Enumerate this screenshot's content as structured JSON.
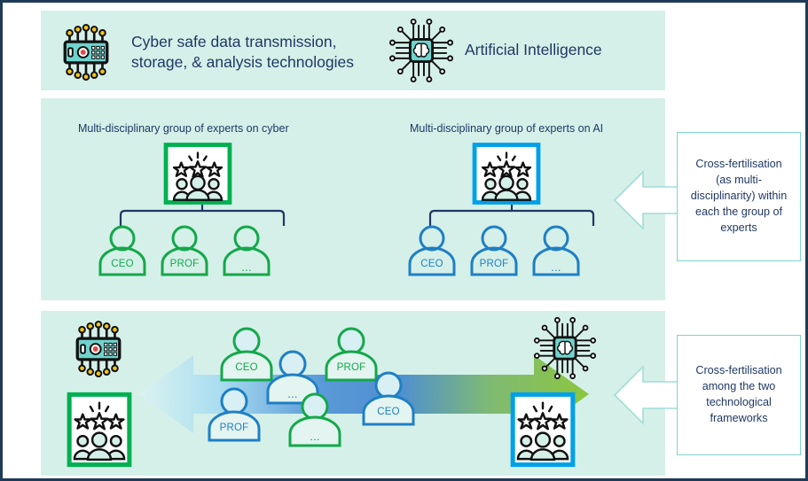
{
  "colors": {
    "page_border": "#1f3a56",
    "panel_bg": "#d5f0e9",
    "text_navy": "#1f3864",
    "green": "#00b050",
    "blue": "#00a0e9",
    "green_person": "#14a84a",
    "blue_person": "#1f7fc4",
    "callout_border": "#7fd4ce",
    "arrow_left_end": "#d8f2f0",
    "arrow_mid": "#4f8fd0",
    "arrow_right_end": "#8cc63f"
  },
  "header": {
    "items": [
      {
        "icon": "safe-chip-icon",
        "label": "Cyber safe data transmission,\nstorage, & analysis technologies"
      },
      {
        "icon": "ai-brain-chip-icon",
        "label": "Artificial Intelligence"
      }
    ],
    "cyber_line1": "Cyber safe data transmission,",
    "cyber_line2": "storage, & analysis technologies",
    "ai_label": "Artificial Intelligence"
  },
  "middle": {
    "groups": [
      {
        "label": "Multi-disciplinary group of experts on cyber",
        "accent": "green",
        "experts": [
          "CEO",
          "PROF",
          "..."
        ]
      },
      {
        "label": "Multi-disciplinary group of experts on AI",
        "accent": "blue",
        "experts": [
          "CEO",
          "PROF",
          "..."
        ]
      }
    ],
    "cyber_label": "Multi-disciplinary group of experts on cyber",
    "ai_label": "Multi-disciplinary group of experts on AI",
    "cyber_experts": {
      "e0": "CEO",
      "e1": "PROF",
      "e2": "..."
    },
    "ai_experts": {
      "e0": "CEO",
      "e1": "PROF",
      "e2": "..."
    }
  },
  "bottom": {
    "left_icons": [
      "safe-chip-icon",
      "experts-group-green-icon"
    ],
    "right_icons": [
      "ai-brain-chip-icon",
      "experts-group-blue-icon"
    ],
    "mixed_experts": [
      {
        "label": "CEO",
        "accent": "green"
      },
      {
        "label": "...",
        "accent": "blue"
      },
      {
        "label": "PROF",
        "accent": "green"
      },
      {
        "label": "CEO",
        "accent": "blue"
      },
      {
        "label": "PROF",
        "accent": "blue"
      },
      {
        "label": "...",
        "accent": "green"
      }
    ],
    "p0": "CEO",
    "p1": "...",
    "p2": "PROF",
    "p3": "CEO",
    "p4": "PROF",
    "p5": "..."
  },
  "callouts": {
    "first": "Cross-fertilisation (as multi-disciplinarity) within each the group of experts",
    "second": "Cross-fertilisation among the two technological frameworks"
  }
}
